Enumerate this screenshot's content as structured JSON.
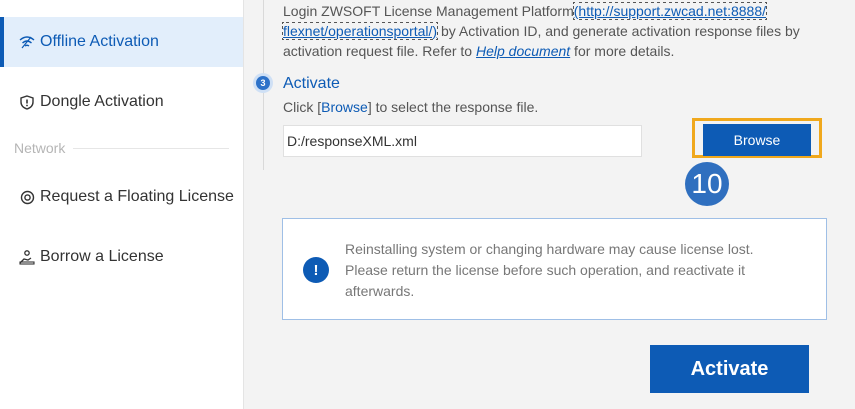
{
  "sidebar": {
    "items": [
      {
        "label": "Offline Activation",
        "icon": "wifi-icon"
      },
      {
        "label": "Dongle Activation",
        "icon": "shield-icon"
      },
      {
        "label": "Request a Floating License",
        "icon": "network-icon"
      },
      {
        "label": "Borrow a License",
        "icon": "borrow-icon"
      }
    ],
    "section_network": "Network"
  },
  "step2": {
    "text_start": "Login ZWSOFT License Management Platform",
    "link_line1": "(http://support.zwcad.net:8888/",
    "link_line2": "flexnet/operationsportal/)",
    "text_mid": " by Activation ID, and generate activation response files by activation request file. Refer to ",
    "help_link": "Help document",
    "text_end": " for more details."
  },
  "step3": {
    "badge": "3",
    "title": "Activate",
    "desc_start": "Click [",
    "desc_keyword": "Browse",
    "desc_end": "] to select the response file.",
    "file_value": "D:/responseXML.xml",
    "browse_label": "Browse",
    "callout_number": "10"
  },
  "notice": {
    "icon": "!",
    "text_line1": "Reinstalling system or changing hardware may cause license lost.",
    "text_line2": "Please return the license before such operation, and reactivate it",
    "text_line3": "afterwards."
  },
  "activate_button": "Activate",
  "colors": {
    "accent": "#0d5bb5",
    "highlight": "#f0a81c"
  }
}
